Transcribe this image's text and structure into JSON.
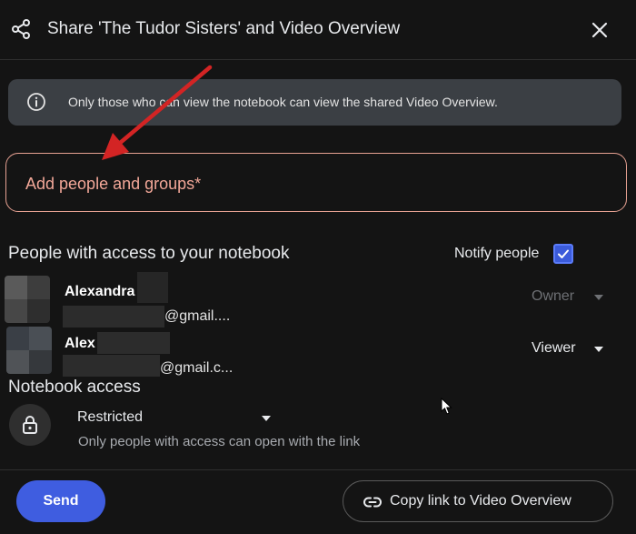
{
  "dialog": {
    "title": "Share 'The Tudor Sisters' and Video Overview",
    "icons": {
      "share": "share-icon",
      "close": "close-icon"
    }
  },
  "info_banner": {
    "icon": "info-icon",
    "text": "Only those who can view the notebook can view the shared Video Overview."
  },
  "add_people": {
    "placeholder": "Add people and groups*",
    "value": ""
  },
  "people_section": {
    "title": "People with access to your notebook",
    "notify_label": "Notify people",
    "notify_checked": true,
    "people": [
      {
        "name": "Alexandra",
        "email_suffix": "@gmail....",
        "role": "Owner",
        "role_enabled": false
      },
      {
        "name": "Alex",
        "email_suffix": "@gmail.c...",
        "role": "Viewer",
        "role_enabled": true
      }
    ]
  },
  "notebook_access": {
    "title": "Notebook access",
    "icon": "lock-icon",
    "selected": "Restricted",
    "description": "Only people with access can open with the link"
  },
  "footer": {
    "send_label": "Send",
    "copy_link_label": "Copy link to Video Overview",
    "copy_icon": "link-icon"
  },
  "colors": {
    "background": "#141414",
    "accent": "#3f5de0",
    "input_border": "#e6a192",
    "placeholder": "#f2a798",
    "annotation_arrow": "#d32424"
  }
}
